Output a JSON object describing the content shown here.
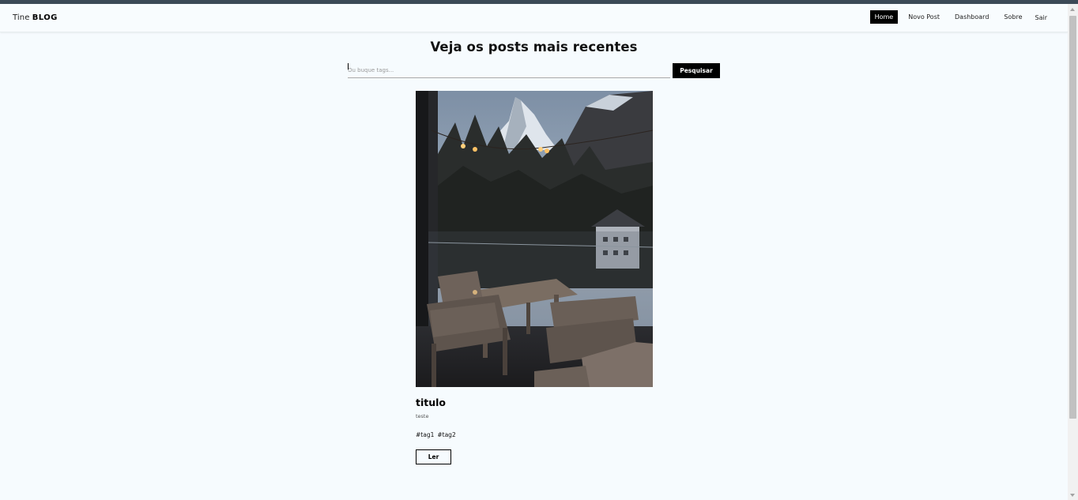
{
  "brand": {
    "prefix": "Tine",
    "name": "BLOG"
  },
  "nav": {
    "home": "Home",
    "new_post": "Novo Post",
    "dashboard": "Dashboard",
    "about": "Sobre",
    "logout": "Sair"
  },
  "page": {
    "title": "Veja os posts mais recentes"
  },
  "search": {
    "placeholder": "Ou buque tags...",
    "value": "",
    "button_label": "Pesquisar"
  },
  "posts": [
    {
      "title": "titulo",
      "body": "teste",
      "tags": [
        "#tag1",
        "#tag2"
      ],
      "read_label": "Ler"
    }
  ],
  "colors": {
    "accent": "#000000",
    "background": "#f6fbfe",
    "topstrip": "#3c4a57"
  }
}
